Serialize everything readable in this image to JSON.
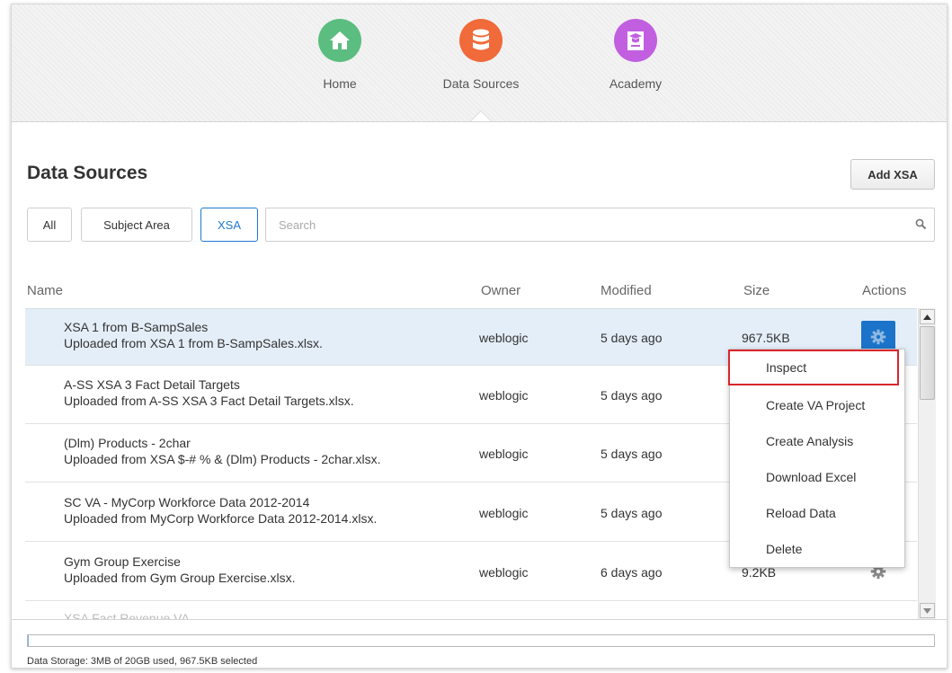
{
  "nav": [
    {
      "label": "Home",
      "color": "#5bbd7f",
      "icon": "home-icon"
    },
    {
      "label": "Data Sources",
      "color": "#f06a3a",
      "icon": "database-icon"
    },
    {
      "label": "Academy",
      "color": "#c15fe0",
      "icon": "academy-icon"
    }
  ],
  "page": {
    "title": "Data Sources",
    "add_button": "Add XSA"
  },
  "filters": {
    "all": "All",
    "subject_area": "Subject Area",
    "xsa": "XSA",
    "active": "XSA"
  },
  "search": {
    "placeholder": "Search",
    "value": ""
  },
  "table": {
    "headers": {
      "name": "Name",
      "owner": "Owner",
      "modified": "Modified",
      "size": "Size",
      "actions": "Actions"
    },
    "rows": [
      {
        "name": "XSA 1 from B-SampSales",
        "desc": "Uploaded from XSA 1 from B-SampSales.xlsx.",
        "owner": "weblogic",
        "modified": "5 days ago",
        "size": "967.5KB",
        "selected": true
      },
      {
        "name": "A-SS XSA 3 Fact Detail Targets",
        "desc": "Uploaded from A-SS XSA 3 Fact Detail Targets.xlsx.",
        "owner": "weblogic",
        "modified": "5 days ago",
        "size": ""
      },
      {
        "name": "(Dlm) Products - 2char",
        "desc": "Uploaded from XSA $-# % & (Dlm) Products - 2char.xlsx.",
        "owner": "weblogic",
        "modified": "5 days ago",
        "size": ""
      },
      {
        "name": "SC VA - MyCorp Workforce Data 2012-2014",
        "desc": "Uploaded from MyCorp Workforce Data 2012-2014.xlsx.",
        "owner": "weblogic",
        "modified": "5 days ago",
        "size": ""
      },
      {
        "name": "Gym Group Exercise",
        "desc": "Uploaded from Gym Group Exercise.xlsx.",
        "owner": "weblogic",
        "modified": "6 days ago",
        "size": "9.2KB"
      },
      {
        "name": "XSA Fact Revenue VA",
        "desc": "",
        "owner": "",
        "modified": "",
        "size": ""
      }
    ]
  },
  "context_menu": {
    "items": [
      "Inspect",
      "Create VA Project",
      "Create Analysis",
      "Download Excel",
      "Reload Data",
      "Delete"
    ],
    "highlighted": "Inspect"
  },
  "footer": {
    "storage_text": "Data Storage: 3MB of 20GB used, 967.5KB selected",
    "storage_fraction": 0.00015
  },
  "colors": {
    "accent": "#1b74c9",
    "highlight_border": "#d9262c",
    "selected_row": "#e4eef8"
  }
}
